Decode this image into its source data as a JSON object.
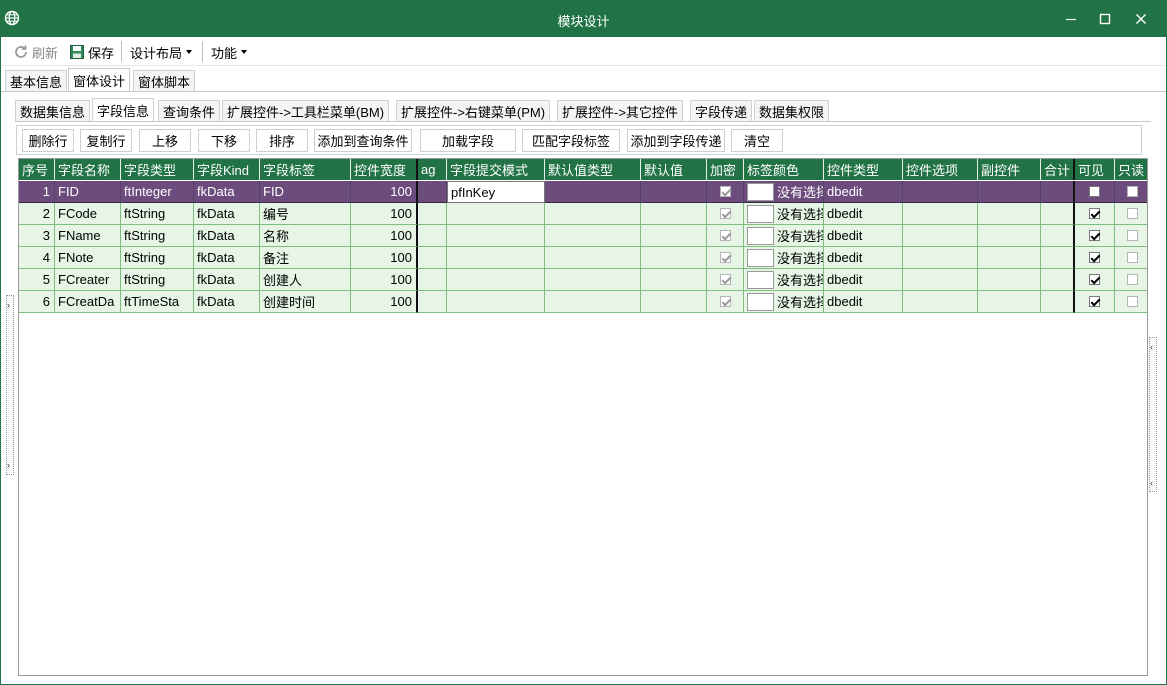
{
  "window": {
    "title": "模块设计",
    "colors": {
      "accent": "#217346",
      "selected_row": "#6b4c7c",
      "row_bg": "#e6f5e6"
    }
  },
  "toolbar": {
    "refresh_label": "刷新",
    "save_label": "保存",
    "layout_label": "设计布局",
    "function_label": "功能"
  },
  "tabs_top": [
    "基本信息",
    "窗体设计",
    "窗体脚本"
  ],
  "tabs_inner": [
    "数据集信息",
    "字段信息",
    "查询条件",
    "扩展控件->工具栏菜单(BM)",
    "扩展控件->右键菜单(PM)",
    "扩展控件->其它控件",
    "字段传递",
    "数据集权限"
  ],
  "actions": [
    "删除行",
    "复制行",
    "上移",
    "下移",
    "排序",
    "添加到查询条件",
    "加载字段",
    "匹配字段标签",
    "添加到字段传递",
    "清空"
  ],
  "grid": {
    "columns": [
      "序号",
      "字段名称",
      "字段类型",
      "字段Kind",
      "字段标签",
      "控件宽度",
      "ag",
      "字段提交模式",
      "默认值类型",
      "默认值",
      "加密",
      "标签颜色",
      "控件类型",
      "控件选项",
      "副控件",
      "合计",
      "可见",
      "只读"
    ],
    "rows": [
      {
        "no": "1",
        "name": "FID",
        "type": "ftInteger",
        "kind": "fkData",
        "label": "FID",
        "width": "100",
        "submit": "pfInKey",
        "encrypt": true,
        "color": "没有选择",
        "ctrl": "dbedit",
        "visible": false,
        "readonly": false
      },
      {
        "no": "2",
        "name": "FCode",
        "type": "ftString",
        "kind": "fkData",
        "label": "编号",
        "width": "100",
        "submit": "",
        "encrypt": true,
        "color": "没有选择",
        "ctrl": "dbedit",
        "visible": true,
        "readonly": false
      },
      {
        "no": "3",
        "name": "FName",
        "type": "ftString",
        "kind": "fkData",
        "label": "名称",
        "width": "100",
        "submit": "",
        "encrypt": true,
        "color": "没有选择",
        "ctrl": "dbedit",
        "visible": true,
        "readonly": false
      },
      {
        "no": "4",
        "name": "FNote",
        "type": "ftString",
        "kind": "fkData",
        "label": "备注",
        "width": "100",
        "submit": "",
        "encrypt": true,
        "color": "没有选择",
        "ctrl": "dbedit",
        "visible": true,
        "readonly": false
      },
      {
        "no": "5",
        "name": "FCreater",
        "type": "ftString",
        "kind": "fkData",
        "label": "创建人",
        "width": "100",
        "submit": "",
        "encrypt": true,
        "color": "没有选择",
        "ctrl": "dbedit",
        "visible": true,
        "readonly": false
      },
      {
        "no": "6",
        "name": "FCreatDa",
        "type": "ftTimeSta",
        "kind": "fkData",
        "label": "创建时间",
        "width": "100",
        "submit": "",
        "encrypt": true,
        "color": "没有选择",
        "ctrl": "dbedit",
        "visible": true,
        "readonly": false
      }
    ]
  }
}
